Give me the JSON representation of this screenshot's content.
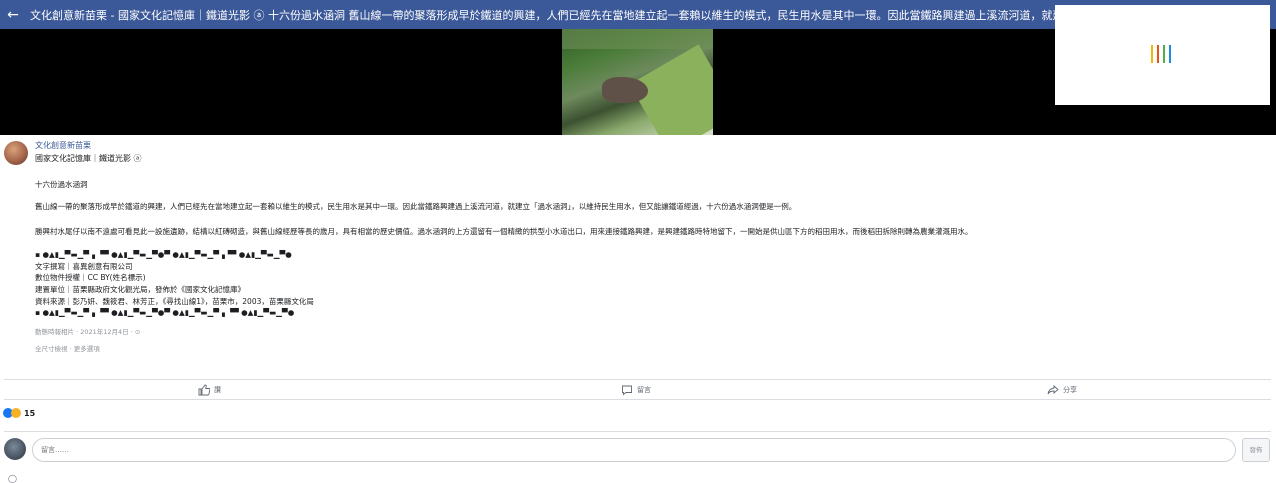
{
  "topbar": {
    "title": "文化創意新苗栗 - 國家文化記憶庫｜鐵道光影 ⓐ 十六份過水涵洞 舊山線一帶的聚落形成早於鐵道的興建，人們已經先在當地建立起一套賴以維生的模式，民生用水是其中一環。因此當鐵路興建過上溪流河道，就建立「過",
    "back_glyph": "←"
  },
  "ad": {
    "bar_colors": [
      "#f2b705",
      "#e94e1b",
      "#4caf50",
      "#1e88e5"
    ]
  },
  "post": {
    "page_name": "文化創意新苗栗",
    "subtitle": "國家文化記憶庫｜鐵道光影 ⓐ",
    "heading": "十六份過水涵洞",
    "para1": "舊山線一帶的聚落形成早於鐵道的興建，人們已經先在當地建立起一套賴以維生的模式，民生用水是其中一環。因此當鐵路興建過上溪流河道，就建立「過水涵洞」，以維持民生用水，但又能讓鐵道經過，十六份過水涵洞便是一例。",
    "para2": "勝興村水尾仔以南不遠處可看見此一設施遺跡，結構以紅磚砌造，與舊山線經歷等長的歲月，具有相當的歷史價值。過水涵洞的上方還留有一個精緻的拱型小水道出口，用來連接鐵路興建，是興建鐵路時特地留下，一開始是供山區下方的稻田用水，而後稻田拆除則轉為農業灌溉用水。",
    "divider_line": "▪ ●▲▮▁▀▬▁▀▗ ▝▀ ●▲▮▁▀▬▁▀●▀ ●▲▮▁▀▬▁▀▗▝▀ ●▲▮▁▀▬▁▀●",
    "credit1": "文字撰寫｜喜異創意有限公司",
    "credit2": "數位物件授權｜CC BY(姓名標示)",
    "credit3": "建置單位｜苗栗縣政府文化觀光局，發佈於《國家文化記憶庫》",
    "credit4": "資料來源｜彭乃妍、魏筱君、林芳正，《尋找山線1》，苗栗市，2003，苗栗縣文化局",
    "divider_line2": "▪ ●▲▮▁▀▬▁▀▗ ▝▀ ●▲▮▁▀▬▁▀●▀ ●▲▮▁▀▬▁▀▗ ▝▀ ●▲▮▁▀▬▁▀●",
    "meta1": "動態時報相片 · 2021年12月4日 · ⊙",
    "meta2": "全尺寸檢視 · 更多選項"
  },
  "actions": {
    "like": "讚",
    "comment": "留言",
    "share": "分享"
  },
  "reactions": {
    "count": "15"
  },
  "comment_box": {
    "placeholder": "留言……",
    "send": "發佈"
  }
}
